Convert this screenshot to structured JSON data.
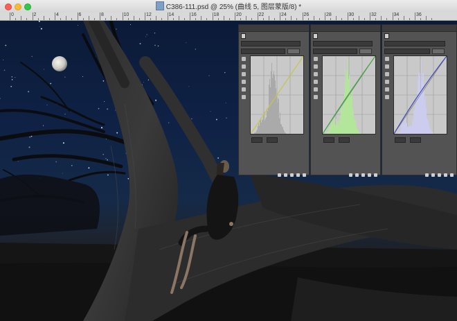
{
  "window": {
    "title": "C386-111.psd @ 25% (曲线 5, 图层蒙版/8) *"
  },
  "ruler": {
    "labels": [
      "0",
      "2",
      "4",
      "6",
      "8",
      "10",
      "12",
      "14",
      "16",
      "18",
      "20",
      "22",
      "24",
      "26",
      "28",
      "30",
      "32",
      "34",
      "36"
    ]
  },
  "panels": [
    {
      "id": "curves-rgb",
      "header": "",
      "preset_value": "",
      "channel_value": "",
      "auto_label": "",
      "input_label": "",
      "output_label": "",
      "histogram_color": "#aaaaaa",
      "curve_color": "#c6c64a",
      "shift": 0.0
    },
    {
      "id": "curves-green",
      "header": "",
      "preset_value": "",
      "channel_value": "",
      "auto_label": "",
      "input_label": "",
      "output_label": "",
      "histogram_color": "#b3e59a",
      "curve_color": "#3fa83f",
      "shift": 0.15
    },
    {
      "id": "curves-blue",
      "header": "",
      "preset_value": "",
      "channel_value": "",
      "auto_label": "",
      "input_label": "",
      "output_label": "",
      "histogram_color": "#ccccee",
      "curve_color": "#3f44b8",
      "shift": 0.25
    }
  ],
  "colors": {
    "sky": "#0f2246",
    "panel_bg": "#535353",
    "title_bar": "#e0e0e0"
  }
}
